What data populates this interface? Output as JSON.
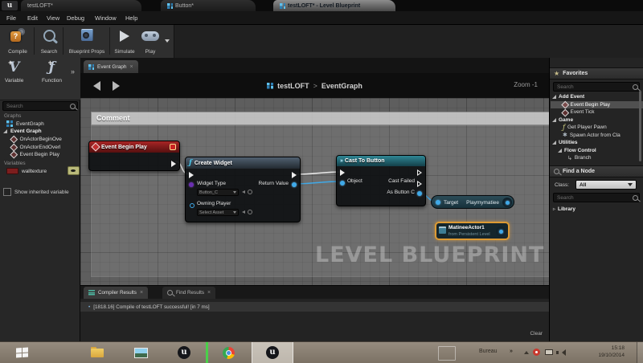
{
  "glyphs": {
    "logo": "u",
    "close": "×",
    "chevrons": "»",
    "bullet": "•",
    "star": "★",
    "fn": "ƒ",
    "spawn": "✱",
    "branch": "↳",
    "collapsed_arrow": "▹",
    "question": "?",
    "cast": "»"
  },
  "window": {
    "tabs": [
      {
        "label": "testLOFT*"
      },
      {
        "label": "Button*"
      },
      {
        "label": "testLOFT* - Level Blueprint"
      }
    ],
    "menus": [
      "File",
      "Edit",
      "View",
      "Debug",
      "Window",
      "Help"
    ]
  },
  "toolbar": {
    "compile": "Compile",
    "search": "Search",
    "blueprint_props": "Blueprint Props",
    "simulate": "Simulate",
    "play": "Play"
  },
  "my_blueprint": {
    "variable": "Variable",
    "function": "Function",
    "search_placeholder": "Search",
    "graphs": "Graphs",
    "eventgraph": "EventGraph",
    "event_graph_group": "Event Graph",
    "events": [
      "OnActorBeginOve",
      "OnActorEndOverl",
      "Event Begin Play"
    ],
    "variables": "Variables",
    "variable_name": "walltexture",
    "show_inherited": "Show inherited variable"
  },
  "graph": {
    "tab": "Event Graph",
    "breadcrumb_root": "testLOFT",
    "breadcrumb_sep": ">",
    "breadcrumb_current": "EventGraph",
    "zoom": "Zoom -1",
    "comment": "Comment",
    "watermark": "LEVEL BLUEPRINT",
    "event_begin_play": {
      "title": "Event Begin Play"
    },
    "create_widget": {
      "title": "Create Widget",
      "widget_type": "Widget Type",
      "widget_type_value": "Button_C",
      "return_value": "Return Value",
      "owning_player": "Owning Player",
      "owning_player_value": "Select Asset"
    },
    "cast_to_button": {
      "title": "Cast To Button",
      "object": "Object",
      "cast_failed": "Cast Failed",
      "as_button": "As Button C"
    },
    "play_matinee": {
      "target": "Target",
      "name": "Playmymatiee"
    },
    "matinee_actor": {
      "name": "MatineeActor1",
      "sub": "from Persistent Level"
    }
  },
  "results": {
    "compiler_tab": "Compiler Results",
    "find_tab": "Find Results",
    "message": "[1818.16] Compile of testLOFT successful! [in 7 ms]",
    "clear": "Clear"
  },
  "favorites": {
    "title": "Favorites",
    "search_placeholder": "Search",
    "items": [
      {
        "label": "Add Event"
      },
      {
        "label": "Event Begin Play"
      },
      {
        "label": "Event Tick"
      },
      {
        "label": "Game"
      },
      {
        "label": "Get Player Pawn"
      },
      {
        "label": "Spawn Actor from Cla"
      },
      {
        "label": "Utilities"
      },
      {
        "label": "Flow Control"
      },
      {
        "label": "Branch"
      }
    ]
  },
  "find_node": {
    "title": "Find a Node",
    "class_label": "Class:",
    "class_value": "All",
    "search_placeholder": "Search",
    "library": "Library"
  },
  "taskbar": {
    "bureau": "Bureau",
    "time": "15:18",
    "date": "19/10/2014"
  },
  "colors": {
    "accent_blue": "#3fa9e8",
    "event_red": "#8f1d1d",
    "cast_teal": "#2f8791",
    "selection_orange": "#dd9a33",
    "compile_orange": "#cd8430"
  }
}
